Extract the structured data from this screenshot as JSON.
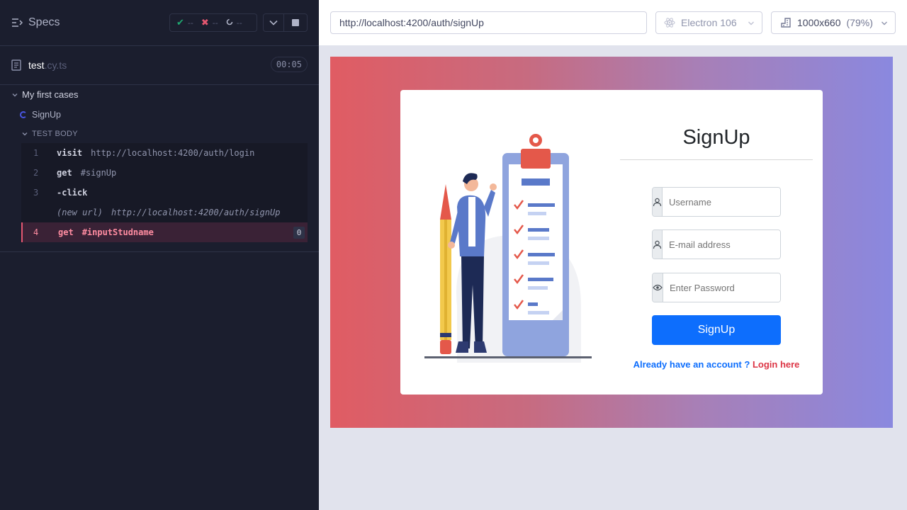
{
  "reporter": {
    "title": "Specs",
    "stats": {
      "passed": "--",
      "failed": "--",
      "pending": "--"
    },
    "file": {
      "name": "test",
      "ext": ".cy.ts",
      "duration": "00:05"
    },
    "suite": "My first cases",
    "test": "SignUp",
    "body_label": "TEST BODY",
    "commands": [
      {
        "num": "1",
        "name": "visit",
        "msg": "http://localhost:4200/auth/login"
      },
      {
        "num": "2",
        "name": "get",
        "msg": "#signUp"
      },
      {
        "num": "3",
        "name": "-click",
        "msg": ""
      },
      {
        "num": "",
        "name": "(new url)",
        "msg": "http://localhost:4200/auth/signUp"
      },
      {
        "num": "4",
        "name": "get",
        "msg": "#inputStudname",
        "count": "0"
      }
    ]
  },
  "aut": {
    "url": "http://localhost:4200/auth/signUp",
    "browser": "Electron 106",
    "viewport": "1000x660",
    "viewport_pct": "(79%)"
  },
  "app": {
    "title": "SignUp",
    "username_placeholder": "Username",
    "email_placeholder": "E-mail address",
    "password_placeholder": "Enter Password",
    "button": "SignUp",
    "account_text": "Already have an account ?",
    "login_link": "Login here"
  },
  "colors": {
    "accent": "#0d6efd",
    "fail": "#e45770",
    "pass": "#1fa971",
    "link_red": "#dc3545"
  }
}
